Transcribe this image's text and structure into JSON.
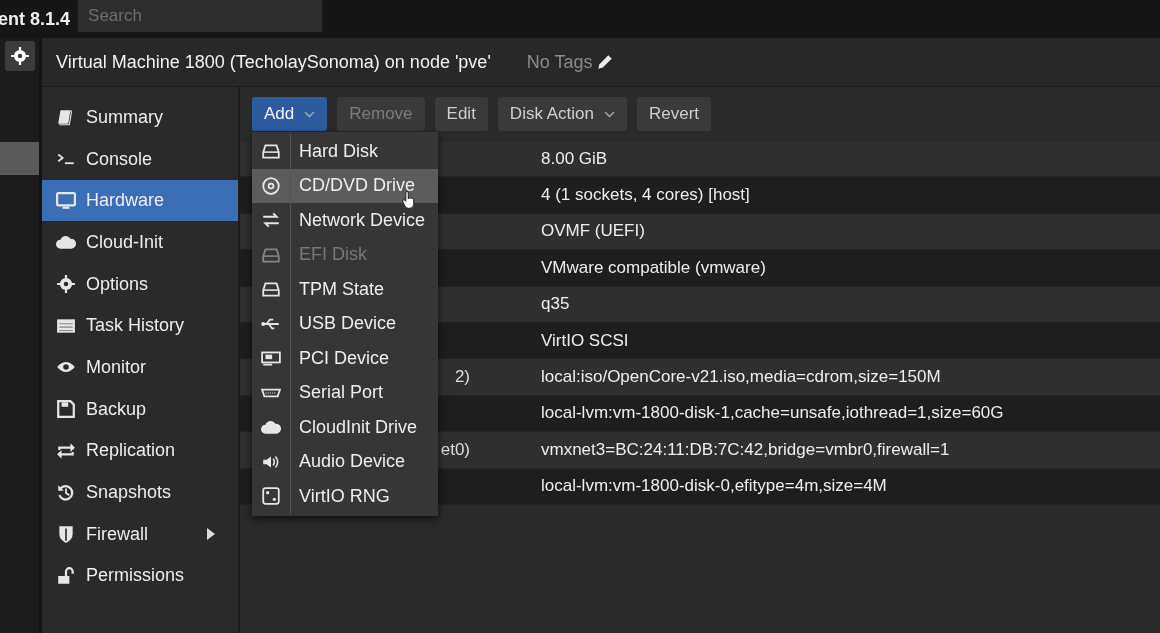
{
  "topbar": {
    "version": "ent 8.1.4",
    "search": {
      "placeholder": "Search"
    }
  },
  "title": {
    "text": "Virtual Machine 1800 (TecholaySonoma) on node 'pve'",
    "tags": "No Tags"
  },
  "sidebar": {
    "items": [
      {
        "label": "Summary",
        "selected": false,
        "expandable": false
      },
      {
        "label": "Console",
        "selected": false,
        "expandable": false
      },
      {
        "label": "Hardware",
        "selected": true,
        "expandable": false
      },
      {
        "label": "Cloud-Init",
        "selected": false,
        "expandable": false
      },
      {
        "label": "Options",
        "selected": false,
        "expandable": false
      },
      {
        "label": "Task History",
        "selected": false,
        "expandable": false
      },
      {
        "label": "Monitor",
        "selected": false,
        "expandable": false
      },
      {
        "label": "Backup",
        "selected": false,
        "expandable": false
      },
      {
        "label": "Replication",
        "selected": false,
        "expandable": false
      },
      {
        "label": "Snapshots",
        "selected": false,
        "expandable": false
      },
      {
        "label": "Firewall",
        "selected": false,
        "expandable": true
      },
      {
        "label": "Permissions",
        "selected": false,
        "expandable": false
      }
    ]
  },
  "toolbar": [
    {
      "label": "Add",
      "kind": "primary",
      "dropdown": true,
      "disabled": false
    },
    {
      "label": "Remove",
      "kind": "plain",
      "dropdown": false,
      "disabled": true
    },
    {
      "label": "Edit",
      "kind": "plain",
      "dropdown": false,
      "disabled": false
    },
    {
      "label": "Disk Action",
      "kind": "plain",
      "dropdown": true,
      "disabled": false
    },
    {
      "label": "Revert",
      "kind": "plain",
      "dropdown": false,
      "disabled": false
    }
  ],
  "add_menu": [
    {
      "label": "Hard Disk",
      "selected": false,
      "disabled": false
    },
    {
      "label": "CD/DVD Drive",
      "selected": true,
      "disabled": false
    },
    {
      "label": "Network Device",
      "selected": false,
      "disabled": false
    },
    {
      "label": "EFI Disk",
      "selected": false,
      "disabled": true
    },
    {
      "label": "TPM State",
      "selected": false,
      "disabled": false
    },
    {
      "label": "USB Device",
      "selected": false,
      "disabled": false
    },
    {
      "label": "PCI Device",
      "selected": false,
      "disabled": false
    },
    {
      "label": "Serial Port",
      "selected": false,
      "disabled": false
    },
    {
      "label": "CloudInit Drive",
      "selected": false,
      "disabled": false
    },
    {
      "label": "Audio Device",
      "selected": false,
      "disabled": false
    },
    {
      "label": "VirtIO RNG",
      "selected": false,
      "disabled": false
    }
  ],
  "table": {
    "rows": [
      {
        "value": "8.00 GiB"
      },
      {
        "value": "4 (1 sockets, 4 cores) [host]"
      },
      {
        "value": "OVMF (UEFI)"
      },
      {
        "value": "VMware compatible (vmware)"
      },
      {
        "value": "q35"
      },
      {
        "value": "VirtIO SCSI"
      },
      {
        "column_1": "2)",
        "value": "local:iso/OpenCore-v21.iso,media=cdrom,size=150M"
      },
      {
        "value": "local-lvm:vm-1800-disk-1,cache=unsafe,iothread=1,size=60G"
      },
      {
        "column_1": "et0)",
        "value": "vmxnet3=BC:24:11:DB:7C:42,bridge=vmbr0,firewall=1"
      },
      {
        "value": "local-lvm:vm-1800-disk-0,efitype=4m,size=4M"
      }
    ]
  }
}
